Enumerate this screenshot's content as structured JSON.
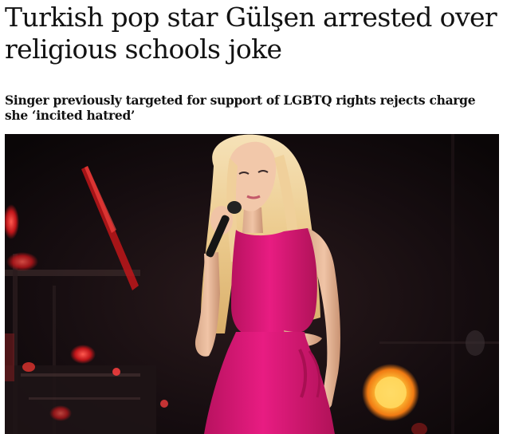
{
  "article": {
    "headline": "Turkish pop star Gülşen arrested over religious schools joke",
    "standfirst": "Singer previously targeted for support of LGBTQ rights rejects charge she ‘incited hatred’",
    "image": {
      "icon": "concert-photo"
    }
  },
  "colors": {
    "text": "#121212",
    "background": "#ffffff",
    "stage_dark": "#140d0f",
    "dress_pink": "#e0197a",
    "hair_blonde": "#f3d7a6",
    "light_orange": "#ffb02e"
  }
}
